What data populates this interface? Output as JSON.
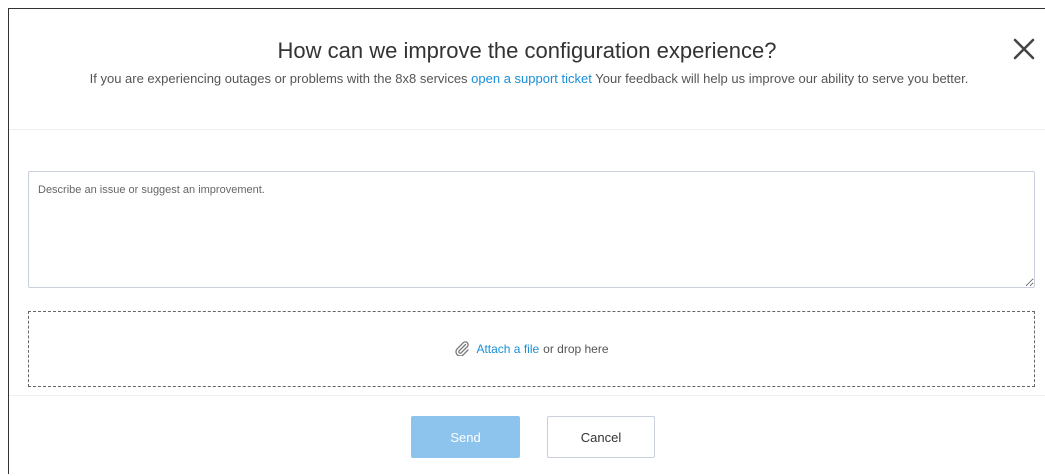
{
  "dialog": {
    "title": "How can we improve the configuration experience?",
    "close_icon": "close-icon",
    "subtitle_before": "If you are experiencing outages or problems with the 8x8 services ",
    "support_link": "open a support ticket",
    "subtitle_after": " Your feedback will help us improve our ability to serve you better."
  },
  "feedback": {
    "placeholder": "Describe an issue or suggest an improvement.",
    "value": ""
  },
  "attachment": {
    "icon": "paperclip-icon",
    "link": "Attach a file",
    "suffix": "or drop here"
  },
  "actions": {
    "send_label": "Send",
    "cancel_label": "Cancel"
  },
  "colors": {
    "link": "#1a8fd8",
    "send_disabled": "#8cc4ee",
    "border": "#c9cfdc"
  }
}
